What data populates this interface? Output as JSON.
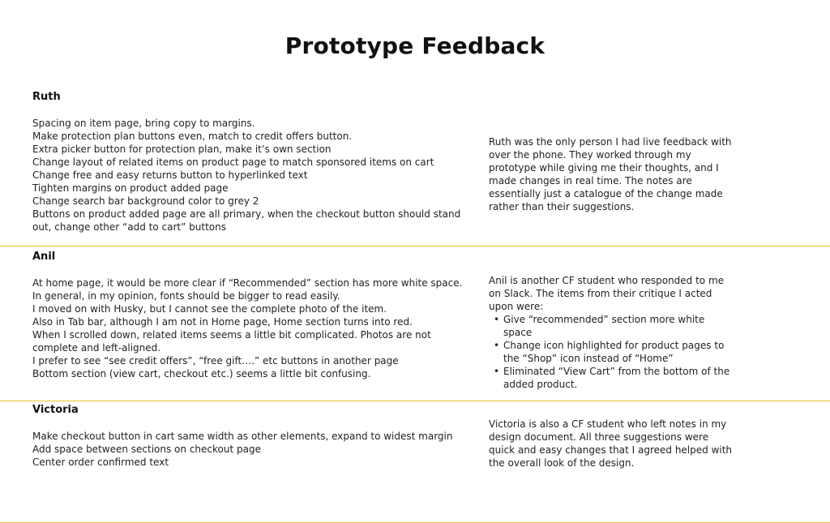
{
  "title": "Prototype Feedback",
  "colors": {
    "divider": "#f2c230",
    "text": "#222222"
  },
  "sections": [
    {
      "name": "Ruth",
      "items": [
        "Spacing on item page, bring copy to margins.",
        "Make protection plan buttons even, match to credit offers button.",
        "Extra picker button for protection plan, make it’s own section",
        "Change layout of related items on product page to match sponsored items on cart",
        "Change free and easy returns button to hyperlinked text",
        "Tighten margins on product added page",
        "Change search bar background color to grey 2",
        "Buttons on product added page are all primary, when the checkout button should stand out, change other “add to cart” buttons"
      ],
      "summary": "Ruth was the only person I had live feedback with over the phone. They worked through my prototype while giving me their thoughts, and I made changes in real time. The notes are essentially just a catalogue of the change made rather than their suggestions."
    },
    {
      "name": "Anil",
      "items": [
        "At home page, it would be more clear if “Recommended” section has more white space.",
        "In general, in my opinion, fonts should be bigger to read easily.",
        "I moved on with Husky, but I cannot see the complete photo of the item.",
        "Also in Tab bar, although I am not in Home page, Home section turns into red.",
        "When I scrolled down, related items seems a little bit complicated. Photos are not complete and left-aligned.",
        "I prefer to see “see credit offers”, “free gift….” etc buttons in another page",
        "Bottom section (view cart, checkout etc.) seems a little bit confusing."
      ],
      "summary": "Anil is another CF student who responded to me on Slack. The items from their critique I acted upon were:",
      "summary_bullets": [
        "Give “recommended” section more white space",
        "Change icon highlighted for product pages to the “Shop” icon instead of “Home”",
        "Eliminated “View Cart” from the bottom of the added product."
      ]
    },
    {
      "name": "Victoria",
      "items": [
        "Make checkout button in cart same width as other elements, expand to widest margin",
        "Add space between sections on checkout page",
        "Center order confirmed text"
      ],
      "summary": "Victoria is also a CF student who left notes in my design document. All three suggestions were quick and easy changes that I agreed helped with the overall look of the design."
    }
  ]
}
